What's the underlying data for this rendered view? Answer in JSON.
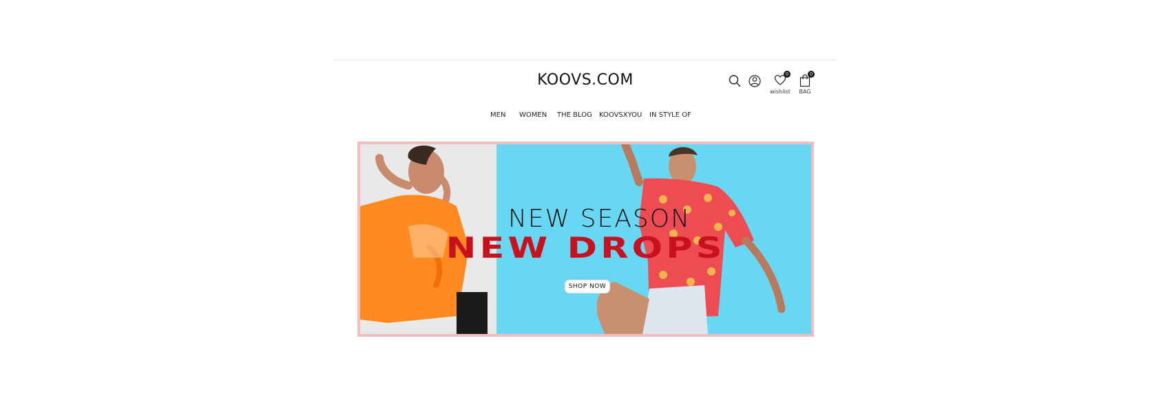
{
  "brand": {
    "logo_text": "KOOVS.COM"
  },
  "header_icons": {
    "search": {
      "name": "search-icon"
    },
    "account": {
      "name": "user-icon"
    },
    "wishlist": {
      "name": "heart-icon",
      "label": "wishlist",
      "count": "0"
    },
    "bag": {
      "name": "bag-icon",
      "label": "BAG",
      "count": "0"
    }
  },
  "nav": {
    "items": [
      {
        "label": "MEN"
      },
      {
        "label": "WOMEN"
      },
      {
        "label": "THE BLOG"
      },
      {
        "label": "KOOVSXYOU"
      },
      {
        "label": "IN STYLE OF"
      }
    ]
  },
  "hero": {
    "line1": "NEW SEASON",
    "line2": "NEW DROPS",
    "cta": "SHOP NOW",
    "colors": {
      "border": "#f8bcbc",
      "sky": "#5bd3f2",
      "left_bg": "#e9e9e9",
      "accent": "#c8101e"
    }
  }
}
